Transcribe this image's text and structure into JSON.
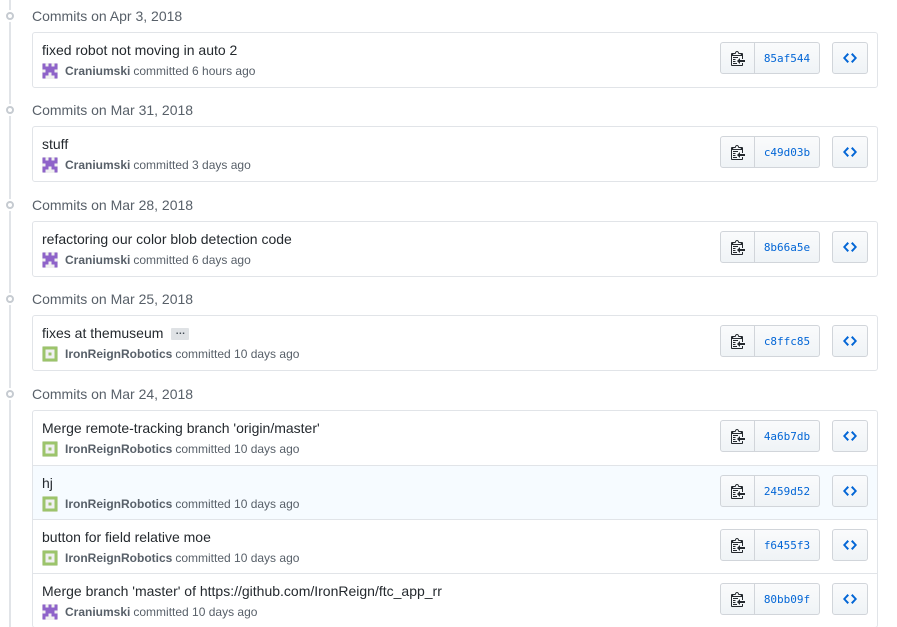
{
  "groups": [
    {
      "title": "Commits on Apr 3, 2018",
      "commits": [
        {
          "message": "fixed robot not moving in auto 2",
          "author": "Craniumski",
          "time": "committed 6 hours ago",
          "sha": "85af544",
          "avatar": "craniumski"
        }
      ]
    },
    {
      "title": "Commits on Mar 31, 2018",
      "commits": [
        {
          "message": "stuff",
          "author": "Craniumski",
          "time": "committed 3 days ago",
          "sha": "c49d03b",
          "avatar": "craniumski"
        }
      ]
    },
    {
      "title": "Commits on Mar 28, 2018",
      "commits": [
        {
          "message": "refactoring our color blob detection code",
          "author": "Craniumski",
          "time": "committed 6 days ago",
          "sha": "8b66a5e",
          "avatar": "craniumski"
        }
      ]
    },
    {
      "title": "Commits on Mar 25, 2018",
      "commits": [
        {
          "message": "fixes at themuseum",
          "author": "IronReignRobotics",
          "time": "committed 10 days ago",
          "sha": "c8ffc85",
          "avatar": "ironreign",
          "has_more": true,
          "more_label": "…"
        }
      ]
    },
    {
      "title": "Commits on Mar 24, 2018",
      "commits": [
        {
          "message": "Merge remote-tracking branch 'origin/master'",
          "author": "IronReignRobotics",
          "time": "committed 10 days ago",
          "sha": "4a6b7db",
          "avatar": "ironreign"
        },
        {
          "message": "hj",
          "author": "IronReignRobotics",
          "time": "committed 10 days ago",
          "sha": "2459d52",
          "avatar": "ironreign",
          "highlight": true
        },
        {
          "message": "button for field relative moe",
          "author": "IronReignRobotics",
          "time": "committed 10 days ago",
          "sha": "f6455f3",
          "avatar": "ironreign"
        },
        {
          "message": "Merge branch 'master' of https://github.com/IronReign/ftc_app_rr",
          "author": "Craniumski",
          "time": "committed 10 days ago",
          "sha": "80bb09f",
          "avatar": "craniumski"
        }
      ]
    }
  ],
  "icons": {
    "copy": "clipboard-icon",
    "browse": "code-icon",
    "timeline": "commit-dot-icon"
  },
  "colors": {
    "sha_link": "#0366d6",
    "avatar_craniumski": "#8e63c9",
    "avatar_ironreign": "#9cc46b",
    "border": "#e1e4e8"
  }
}
